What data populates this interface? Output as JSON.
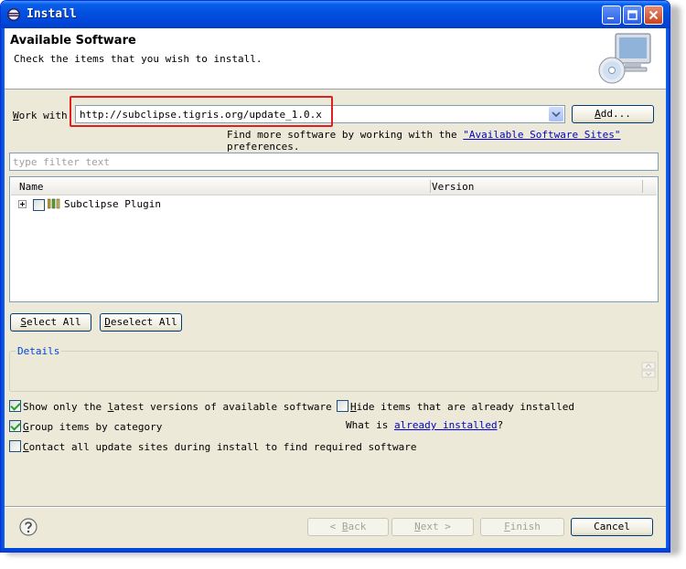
{
  "window": {
    "title": "Install"
  },
  "header": {
    "title": "Available Software",
    "subtitle": "Check the items that you wish to install."
  },
  "work_with": {
    "label_prefix": "",
    "label_mnemonic": "W",
    "label_rest": "ork with:",
    "value": "http://subclipse.tigris.org/update_1.0.x",
    "add_label_mnemonic": "A",
    "add_label_rest": "dd...",
    "find_more_text": "Find more software by working with the",
    "sites_link": "\"Available Software Sites\"",
    "find_more_suffix": "preferences."
  },
  "filter": {
    "placeholder": "type filter text"
  },
  "tree": {
    "columns": [
      "Name",
      "Version"
    ],
    "items": [
      {
        "name": "Subclipse Plugin",
        "version": "",
        "checked": false,
        "expanded": false
      }
    ]
  },
  "selection": {
    "select_all_mnemonic": "S",
    "select_all_rest": "elect All",
    "deselect_all_mnemonic": "D",
    "deselect_all_rest": "eselect All"
  },
  "details": {
    "legend": "Details"
  },
  "options": {
    "latest_pre": "Show only the ",
    "latest_mn": "l",
    "latest_post": "atest versions of available software",
    "latest_checked": true,
    "group_mn": "G",
    "group_post": "roup items by category",
    "group_checked": true,
    "contact_mn": "C",
    "contact_post": "ontact all update sites during install to find required software",
    "contact_checked": false,
    "hide_mn": "H",
    "hide_post": "ide items that are already installed",
    "hide_checked": false,
    "what_is_prefix": "What is",
    "already_installed_link": "already installed",
    "what_is_suffix": "?"
  },
  "footer": {
    "back_mn": "B",
    "back_rest": "ack",
    "next_mn": "N",
    "next_rest": "ext",
    "finish_mn": "F",
    "finish_rest": "inish",
    "cancel_label": "Cancel"
  },
  "colors": {
    "title_bar": "#0050e0",
    "dialog_bg": "#ece9d8",
    "link": "#0000cc",
    "highlight_box": "#e02020",
    "check": "#21a121"
  }
}
